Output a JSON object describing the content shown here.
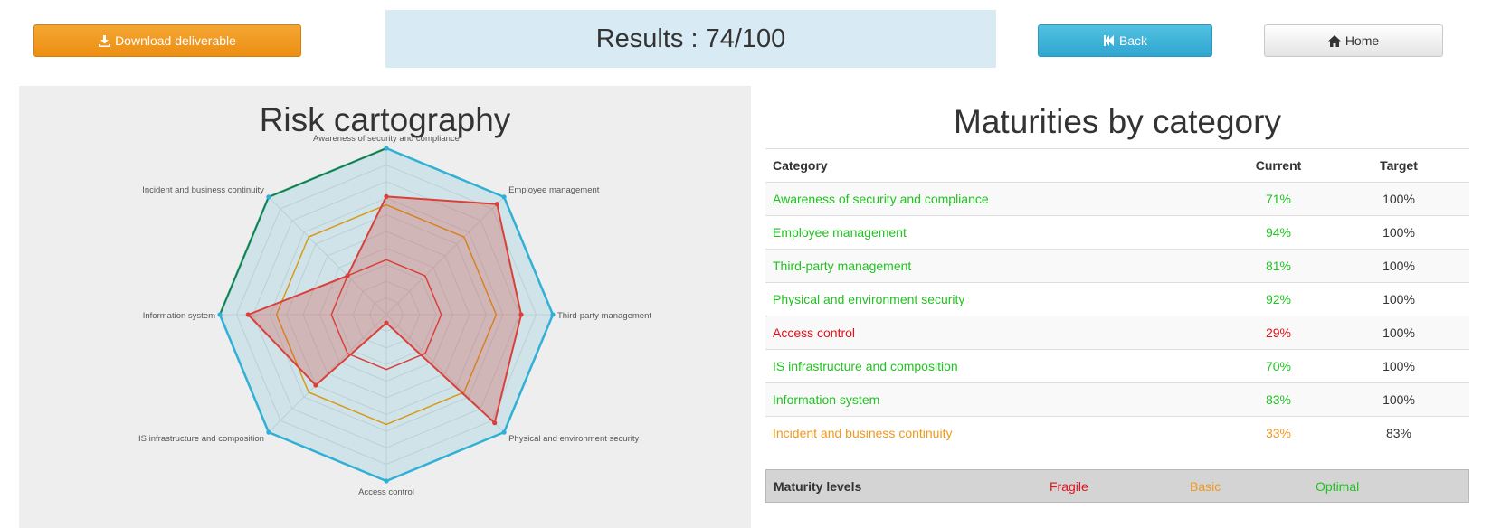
{
  "toolbar": {
    "download_label": "Download deliverable",
    "back_label": "Back",
    "home_label": "Home"
  },
  "results": {
    "text": "Results : 74/100"
  },
  "risk": {
    "title": "Risk cartography"
  },
  "maturities": {
    "title": "Maturities by category",
    "headers": {
      "category": "Category",
      "current": "Current",
      "target": "Target"
    },
    "rows": [
      {
        "category": "Awareness of security and compliance",
        "current": "71%",
        "target": "100%",
        "status": "optimal"
      },
      {
        "category": "Employee management",
        "current": "94%",
        "target": "100%",
        "status": "optimal"
      },
      {
        "category": "Third-party management",
        "current": "81%",
        "target": "100%",
        "status": "optimal"
      },
      {
        "category": "Physical and environment security",
        "current": "92%",
        "target": "100%",
        "status": "optimal"
      },
      {
        "category": "Access control",
        "current": "29%",
        "target": "100%",
        "status": "fragile"
      },
      {
        "category": "IS infrastructure and composition",
        "current": "70%",
        "target": "100%",
        "status": "optimal"
      },
      {
        "category": "Information system",
        "current": "83%",
        "target": "100%",
        "status": "optimal"
      },
      {
        "category": "Incident and business continuity",
        "current": "33%",
        "target": "83%",
        "status": "basic"
      }
    ]
  },
  "levels": {
    "label": "Maturity levels",
    "fragile": "Fragile",
    "basic": "Basic",
    "optimal": "Optimal"
  },
  "colors": {
    "fragile": "#e8101a",
    "basic": "#f0981b",
    "optimal": "#21c221",
    "target": "#31b0d5",
    "current": "#d9403a",
    "reference": "#d89a1a",
    "outline": "#1f7a1f"
  },
  "chart_data": {
    "type": "radar",
    "axes": [
      "Awareness of security and compliance",
      "Employee management",
      "Third-party management",
      "Physical and environment security",
      "Access control",
      "IS infrastructure and composition",
      "Information system",
      "Incident and business continuity"
    ],
    "range": [
      0,
      100
    ],
    "series": [
      {
        "values": [
          100,
          100,
          100,
          100,
          100,
          100,
          100,
          100
        ]
      },
      {
        "values": [
          71,
          94,
          81,
          92,
          5,
          60,
          83,
          33
        ]
      },
      {
        "values": [
          66,
          66,
          66,
          66,
          66,
          66,
          66,
          66
        ]
      },
      {
        "values": [
          33,
          33,
          33,
          33,
          33,
          33,
          33,
          33
        ]
      },
      {
        "values": [
          100,
          null,
          null,
          null,
          null,
          null,
          100,
          100
        ]
      }
    ]
  }
}
